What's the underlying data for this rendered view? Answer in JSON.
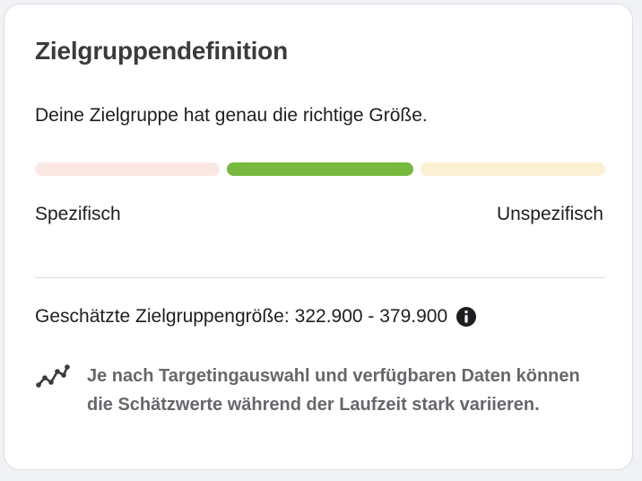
{
  "card": {
    "title": "Zielgruppendefinition",
    "status_text": "Deine Zielgruppe hat genau die richtige Größe.",
    "meter": {
      "segments": [
        {
          "name": "specific",
          "color": "#fbe8e4"
        },
        {
          "name": "ideal",
          "color": "#76b93e",
          "active": true
        },
        {
          "name": "broad",
          "color": "#fcf0d2"
        }
      ],
      "left_label": "Spezifisch",
      "right_label": "Unspezifisch"
    },
    "estimate": {
      "label": "Geschätzte Zielgruppengröße:",
      "value": "322.900 - 379.900",
      "icon": "info-icon"
    },
    "note": {
      "icon": "trend-line-icon",
      "text": "Je nach Targetingauswahl und verfügbaren Daten können die Schätzwerte während der Laufzeit stark variieren."
    }
  }
}
